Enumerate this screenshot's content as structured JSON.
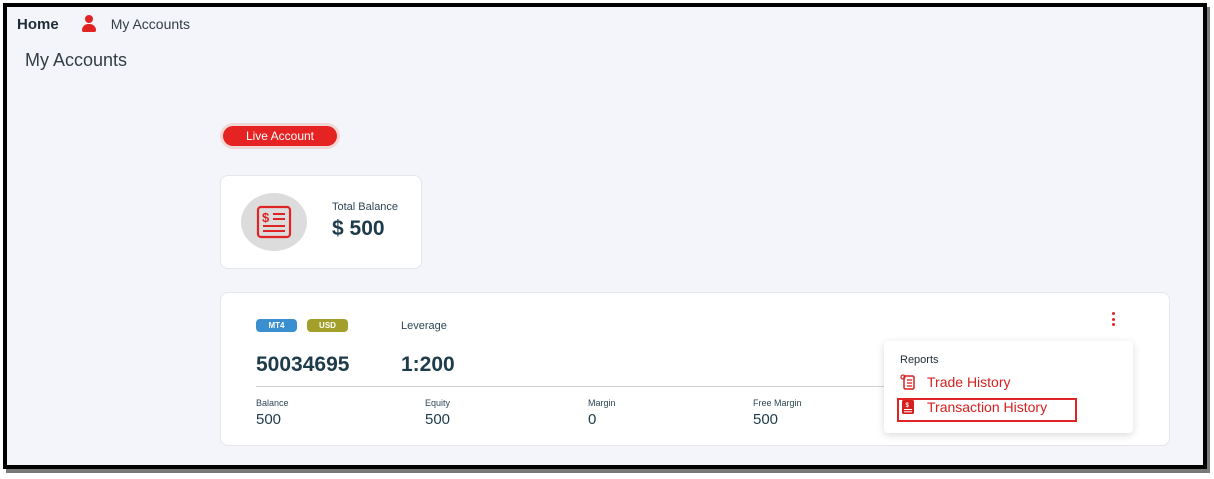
{
  "breadcrumb": {
    "home": "Home",
    "current": "My Accounts"
  },
  "page": {
    "title": "My Accounts"
  },
  "account_type": {
    "label": "Live Account"
  },
  "total_balance": {
    "label": "Total Balance",
    "value": "$ 500"
  },
  "account": {
    "platform_tag": "MT4",
    "currency_tag": "USD",
    "leverage_label": "Leverage",
    "number": "50034695",
    "leverage": "1:200",
    "stats": [
      {
        "label": "Balance",
        "value": "500"
      },
      {
        "label": "Equity",
        "value": "500"
      },
      {
        "label": "Margin",
        "value": "0"
      },
      {
        "label": "Free Margin",
        "value": "500"
      }
    ]
  },
  "menu": {
    "heading": "Reports",
    "items": [
      {
        "label": "Trade History",
        "icon": "trade-history-icon"
      },
      {
        "label": "Transaction History",
        "icon": "transaction-history-icon"
      }
    ]
  },
  "colors": {
    "accent": "#e52322",
    "mt4": "#3a8fd0",
    "usd": "#a2a02a",
    "text": "#1d3b4a"
  }
}
